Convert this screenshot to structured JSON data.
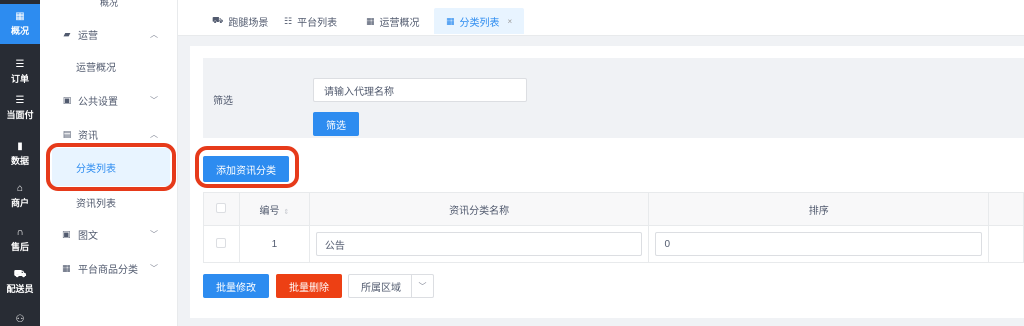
{
  "rail": {
    "items": [
      {
        "label": "概况",
        "icon": "grid-icon",
        "glyph": "▦"
      },
      {
        "label": "订单",
        "icon": "list-icon",
        "glyph": "☰"
      },
      {
        "label": "当面付",
        "icon": "list-icon",
        "glyph": "☰"
      },
      {
        "label": "数据",
        "icon": "bar-chart-icon",
        "glyph": "▮"
      },
      {
        "label": "商户",
        "icon": "store-icon",
        "glyph": "⌂"
      },
      {
        "label": "售后",
        "icon": "headset-icon",
        "glyph": "∩"
      },
      {
        "label": "配送员",
        "icon": "scooter-icon",
        "glyph": "⛟"
      },
      {
        "label": "",
        "icon": "users-icon",
        "glyph": "⚇"
      }
    ],
    "active_color": "#2d8cf0"
  },
  "sidebar": {
    "top_label": "概况",
    "groups": [
      {
        "label": "运营",
        "icon": "bar-icon",
        "expanded": true
      },
      {
        "label": "运营概况"
      },
      {
        "label": "公共设置",
        "icon": "image-icon",
        "expanded": false
      },
      {
        "label": "资讯",
        "icon": "doc-icon",
        "expanded": true
      },
      {
        "label": "分类列表",
        "active": true
      },
      {
        "label": "资讯列表"
      },
      {
        "label": "图文",
        "icon": "image-icon",
        "expanded": false
      },
      {
        "label": "平台商品分类",
        "icon": "grid-icon",
        "expanded": false
      }
    ]
  },
  "tabs": [
    {
      "label": "跑腿场景",
      "icon": "truck-icon"
    },
    {
      "label": "平台列表",
      "icon": "list-icon"
    },
    {
      "label": "运营概况",
      "icon": "grid-icon"
    },
    {
      "label": "分类列表",
      "icon": "grid-icon",
      "active": true,
      "close": "×"
    }
  ],
  "filter": {
    "label": "筛选",
    "input_placeholder": "请输入代理名称",
    "button": "筛选"
  },
  "add_button": "添加资讯分类",
  "table": {
    "headers": [
      "",
      "编号",
      "资讯分类名称",
      "排序",
      ""
    ],
    "rows": [
      {
        "id": "1",
        "name": "公告",
        "sort": "0"
      }
    ]
  },
  "footer": {
    "batch_edit": "批量修改",
    "batch_delete": "批量删除",
    "region_select": "所属区域"
  },
  "colors": {
    "primary": "#2d8cf0",
    "danger": "#ed4014",
    "highlight_ring": "#e63a1a"
  }
}
